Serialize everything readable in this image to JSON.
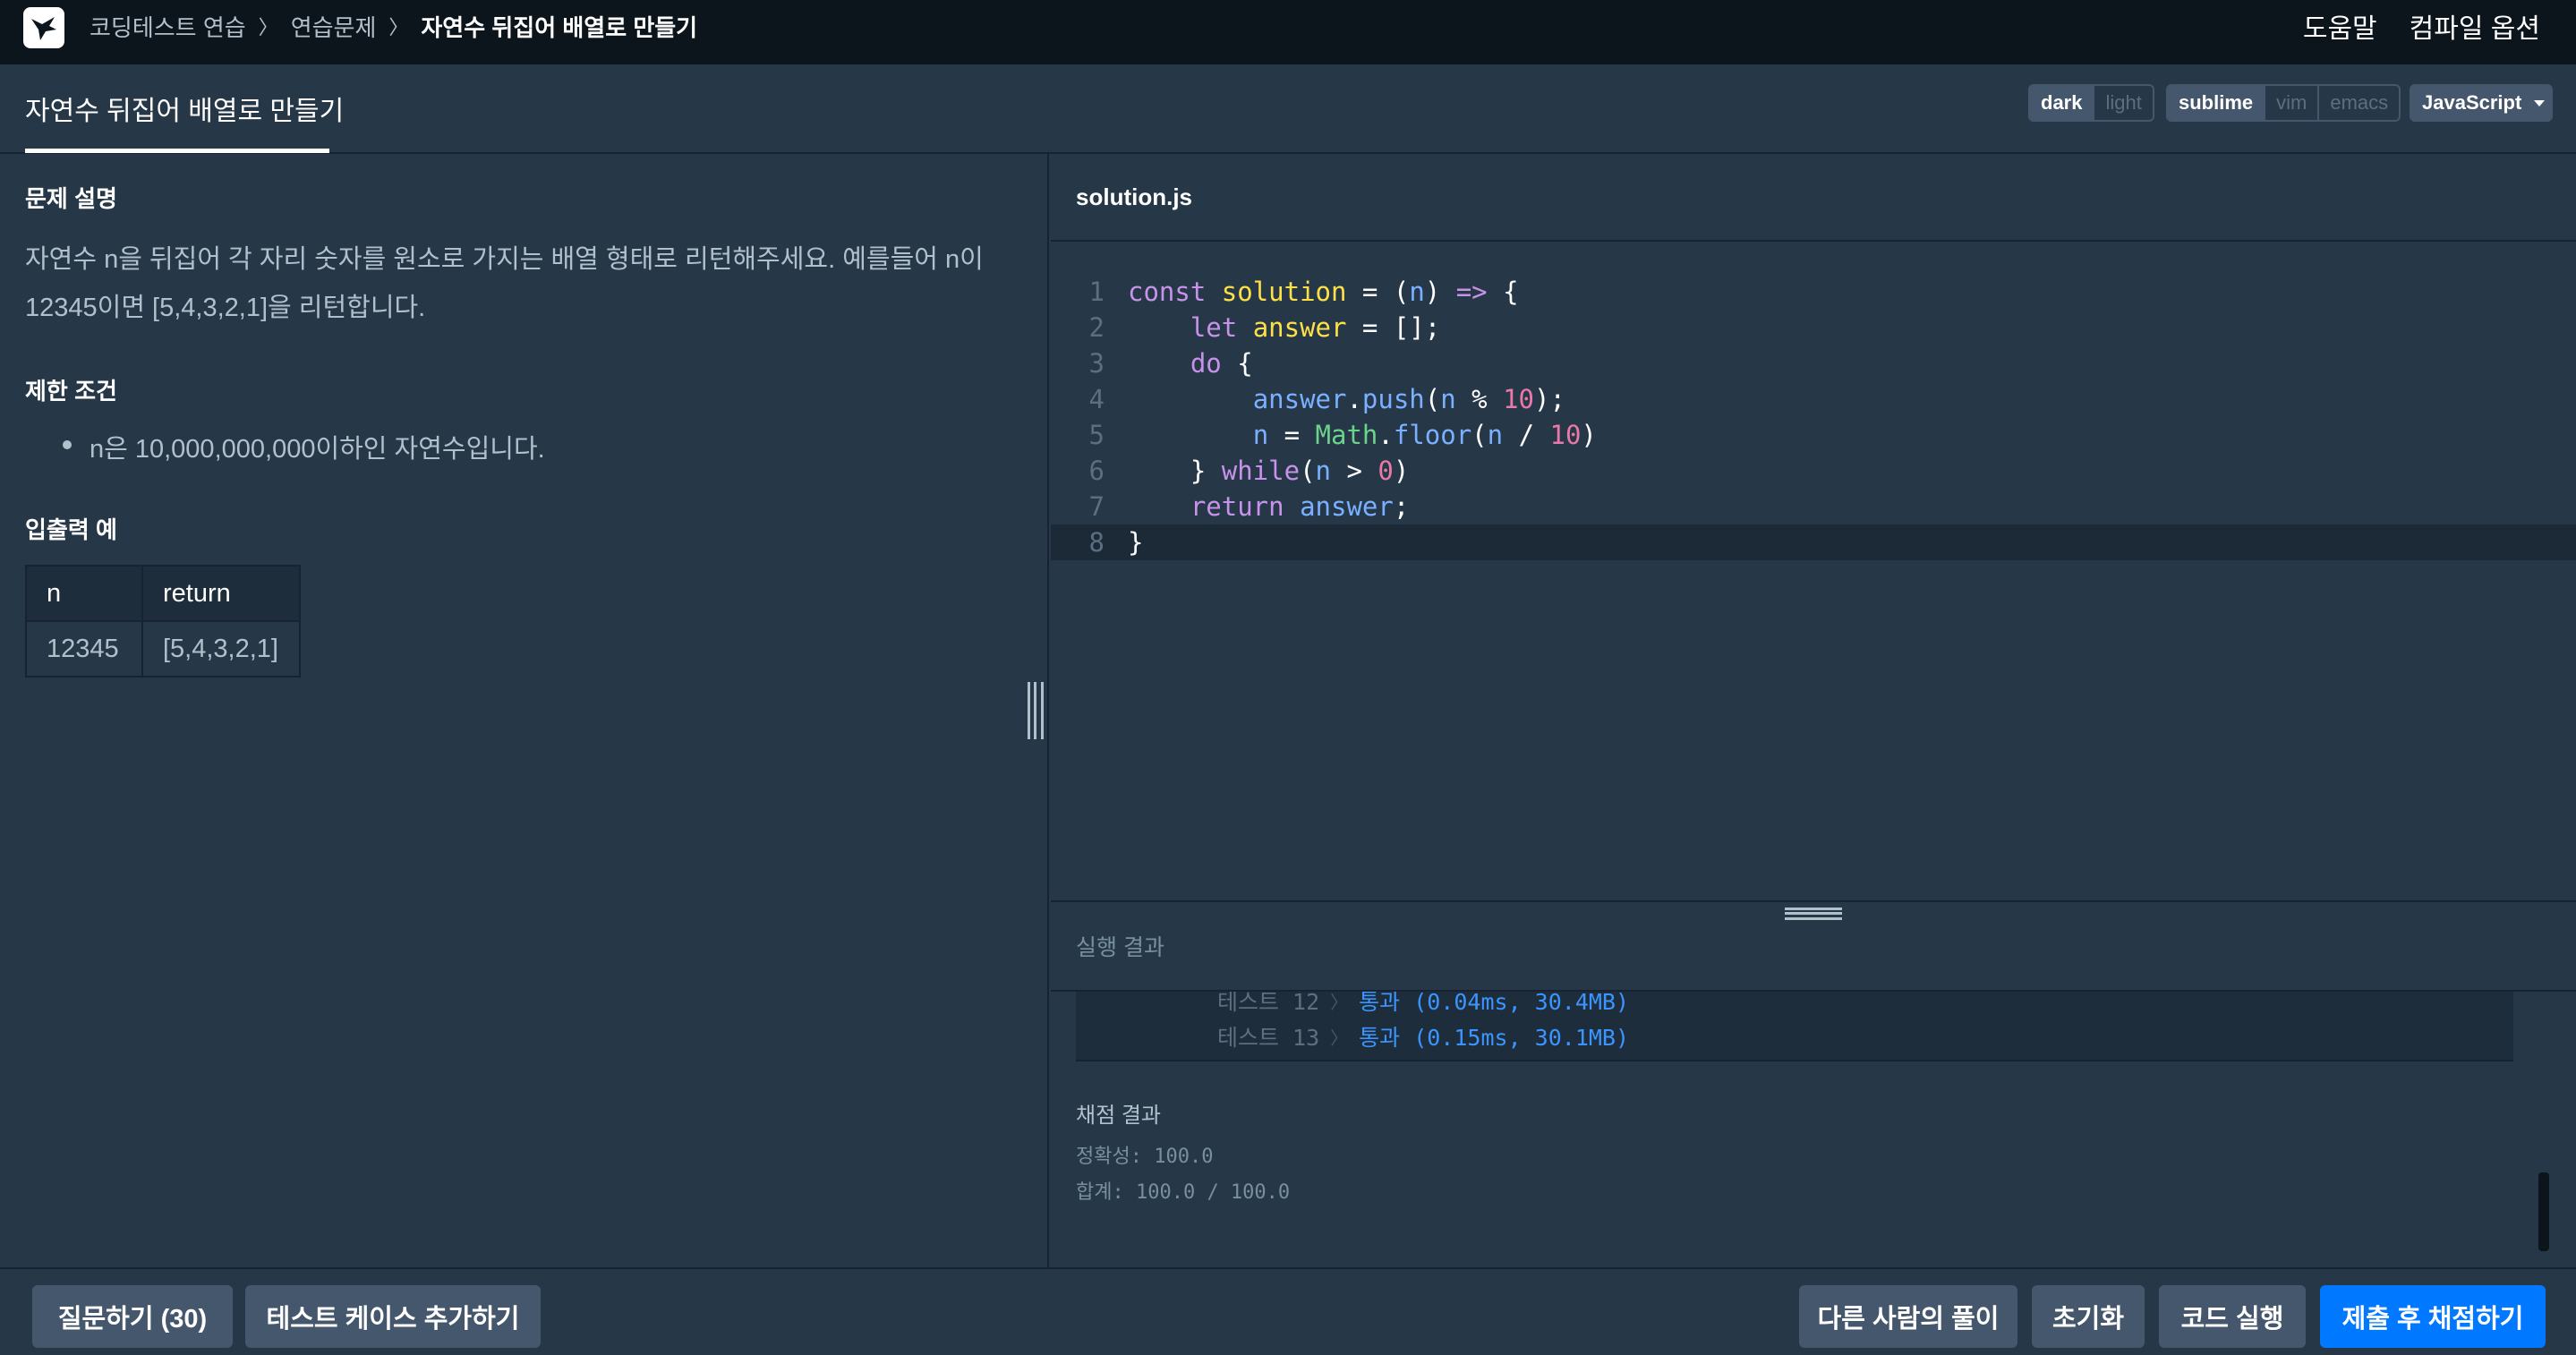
{
  "nav": {
    "breadcrumb": [
      "코딩테스트 연습",
      "연습문제",
      "자연수 뒤집어 배열로 만들기"
    ],
    "help": "도움말",
    "compile_options": "컴파일 옵션"
  },
  "tab": {
    "title": "자연수 뒤집어 배열로 만들기"
  },
  "editor_options": {
    "theme": [
      "dark",
      "light"
    ],
    "theme_selected": "dark",
    "keymap": [
      "sublime",
      "vim",
      "emacs"
    ],
    "keymap_selected": "sublime",
    "language": "JavaScript"
  },
  "problem": {
    "desc_heading": "문제 설명",
    "desc_line1": "자연수 n을 뒤집어 각 자리 숫자를 원소로 가지는 배열 형태로 리턴해주세요. 예를들어 n이",
    "desc_line2": "12345이면 [5,4,3,2,1]을 리턴합니다.",
    "limit_heading": "제한 조건",
    "limits": [
      "n은 10,000,000,000이하인 자연수입니다."
    ],
    "io_heading": "입출력 예",
    "io_headers": [
      "n",
      "return"
    ],
    "io_rows": [
      [
        "12345",
        "[5,4,3,2,1]"
      ]
    ]
  },
  "file": {
    "name": "solution.js",
    "line_numbers": [
      "1",
      "2",
      "3",
      "4",
      "5",
      "6",
      "7",
      "8"
    ]
  },
  "results": {
    "heading": "실행 결과",
    "tests": [
      {
        "label": "테스트 12",
        "value": "통과 (0.04ms, 30.4MB)"
      },
      {
        "label": "테스트 13",
        "value": "통과 (0.15ms, 30.1MB)"
      }
    ],
    "grade_heading": "채점 결과",
    "accuracy": "정확성: 100.0",
    "total": "합계: 100.0 / 100.0"
  },
  "buttons": {
    "ask": "질문하기 (30)",
    "add_testcase": "테스트 케이스 추가하기",
    "others": "다른 사람의 풀이",
    "reset": "초기화",
    "run": "코드 실행",
    "submit": "제출 후 채점하기"
  },
  "colors": {
    "nav_bg": "#0c151c",
    "panel_bg": "#263747",
    "primary": "#0078ff",
    "pass": "#3b95ff"
  }
}
